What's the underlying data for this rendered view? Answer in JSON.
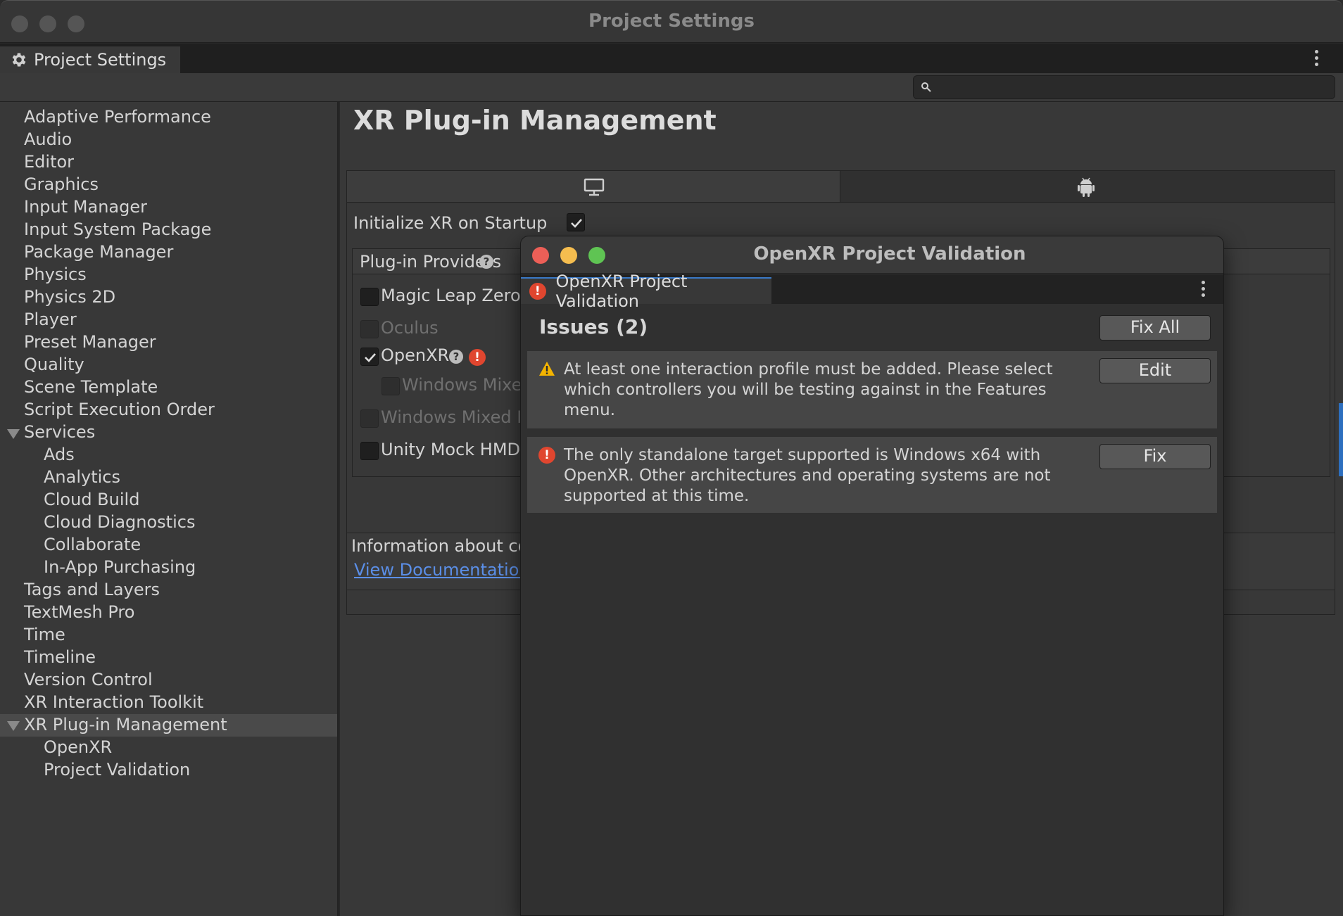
{
  "window": {
    "title": "Project Settings",
    "tab_label": "Project Settings"
  },
  "search": {
    "placeholder": ""
  },
  "sidebar": {
    "items": [
      "Adaptive Performance",
      "Audio",
      "Editor",
      "Graphics",
      "Input Manager",
      "Input System Package",
      "Package Manager",
      "Physics",
      "Physics 2D",
      "Player",
      "Preset Manager",
      "Quality",
      "Scene Template",
      "Script Execution Order",
      "Services",
      "Ads",
      "Analytics",
      "Cloud Build",
      "Cloud Diagnostics",
      "Collaborate",
      "In-App Purchasing",
      "Tags and Layers",
      "TextMesh Pro",
      "Time",
      "Timeline",
      "Version Control",
      "XR Interaction Toolkit",
      "XR Plug-in Management",
      "OpenXR",
      "Project Validation"
    ],
    "selected": "XR Plug-in Management"
  },
  "main": {
    "heading": "XR Plug-in Management",
    "platform_tabs": [
      "desktop-icon",
      "android-icon"
    ],
    "init_label": "Initialize XR on Startup",
    "init_checked": true,
    "providers_title": "Plug-in Providers",
    "providers": [
      {
        "label": "Magic Leap Zero",
        "checked": false,
        "enabled": true
      },
      {
        "label": "Oculus",
        "checked": false,
        "enabled": false
      },
      {
        "label": "OpenXR",
        "checked": true,
        "enabled": true
      },
      {
        "label": "Windows Mixe",
        "checked": false,
        "enabled": false
      },
      {
        "label": "Windows Mixed R",
        "checked": false,
        "enabled": false
      },
      {
        "label": "Unity Mock HMD",
        "checked": false,
        "enabled": true
      }
    ],
    "info_text": "Information about con",
    "doc_link": "View Documentation"
  },
  "modal": {
    "title": "OpenXR Project Validation",
    "tab_label": "OpenXR Project Validation",
    "issues_heading": "Issues (2)",
    "fix_all_label": "Fix All",
    "issues": [
      {
        "severity": "warning",
        "text": "At least one interaction profile must be added.  Please select which controllers you will be testing against in the Features menu.",
        "action": "Edit"
      },
      {
        "severity": "error",
        "text": "The only standalone target supported is Windows x64 with OpenXR.  Other architectures and operating systems are not supported at this time.",
        "action": "Fix"
      }
    ]
  },
  "colors": {
    "error": "#e0462f",
    "warning": "#f4b400",
    "link": "#5b8fe8",
    "close": "#ec5f57",
    "minimize": "#f5bd4f",
    "zoom": "#5fc453"
  }
}
